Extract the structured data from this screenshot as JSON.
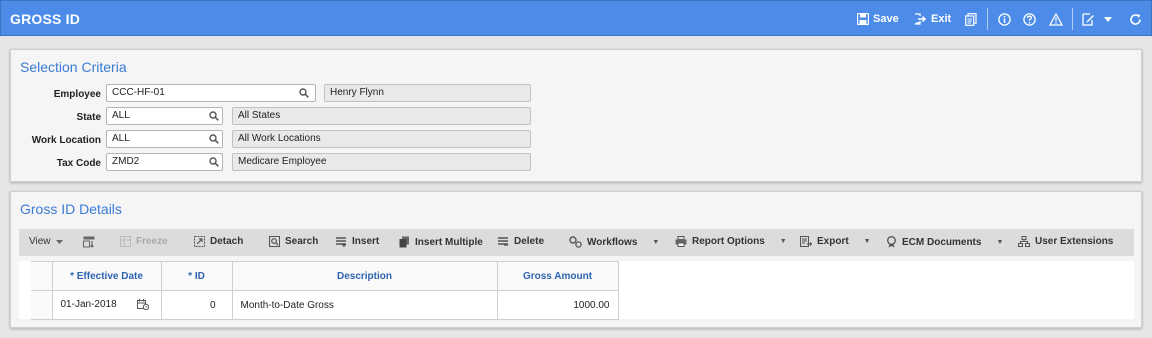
{
  "titlebar": {
    "title": "GROSS ID",
    "save_label": "Save",
    "exit_label": "Exit",
    "icons": [
      "save-icon",
      "exit-icon",
      "documents-icon",
      "info-icon",
      "help-icon",
      "alert-icon",
      "edit-icon",
      "chevron-down-icon",
      "refresh-icon"
    ]
  },
  "selection": {
    "title": "Selection Criteria",
    "fields": [
      {
        "label": "Employee",
        "value": "CCC-HF-01",
        "description": "Henry Flynn"
      },
      {
        "label": "State",
        "value": "ALL",
        "description": "All States"
      },
      {
        "label": "Work Location",
        "value": "ALL",
        "description": "All Work Locations"
      },
      {
        "label": "Tax Code",
        "value": "ZMD2",
        "description": "Medicare Employee"
      }
    ]
  },
  "details": {
    "title": "Gross ID Details",
    "toolbar": {
      "view": "View",
      "freeze": "Freeze",
      "detach": "Detach",
      "search": "Search",
      "insert": "Insert",
      "insert_multiple": "Insert Multiple",
      "delete": "Delete",
      "workflows": "Workflows",
      "report_options": "Report Options",
      "export": "Export",
      "ecm_documents": "ECM Documents",
      "user_extensions": "User Extensions"
    },
    "columns": [
      "* Effective Date",
      "* ID",
      "Description",
      "Gross Amount"
    ],
    "rows": [
      {
        "effective_date": "01-Jan-2018",
        "id": "0",
        "description": "Month-to-Date Gross",
        "gross_amount": "1000.00"
      }
    ]
  },
  "colors": {
    "titlebar": "#4c8ce8",
    "section_title": "#3a7bd5",
    "column_header": "#2d63b0"
  }
}
